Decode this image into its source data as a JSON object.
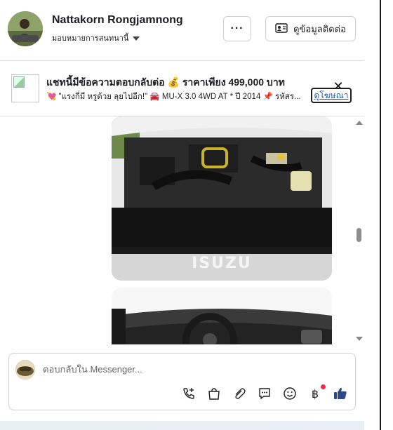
{
  "header": {
    "contact_name": "Nattakorn Rongjamnong",
    "assign_label": "มอบหมายการสนทนานี้",
    "more_label": "···",
    "contact_button_label": "ดูข้อมูลติดต่อ"
  },
  "ad": {
    "title": "แชทนี้มีข้อความตอบกลับต่อ 💰 ราคาเพียง 499,000 บาท",
    "description": "💘 \"แรงกี่มี หรูด้วย ลุยไปอีก!\" 🚘 MU-X 3.0 4WD AT * ปี 2014 📌 รหัสร...",
    "link_label": "ดูโฆษณา",
    "close_label": "✕"
  },
  "composer": {
    "placeholder": "ตอบกลับใน Messenger..."
  },
  "tools": [
    "phone-plus-icon",
    "shopping-bag-icon",
    "paperclip-icon",
    "chat-bubble-icon",
    "smiley-icon",
    "baht-icon",
    "thumbs-up-icon"
  ],
  "colors": {
    "accent_blue": "#1a5fb4",
    "thumbs_up": "#2b4a87",
    "notification_dot": "#f02849"
  }
}
